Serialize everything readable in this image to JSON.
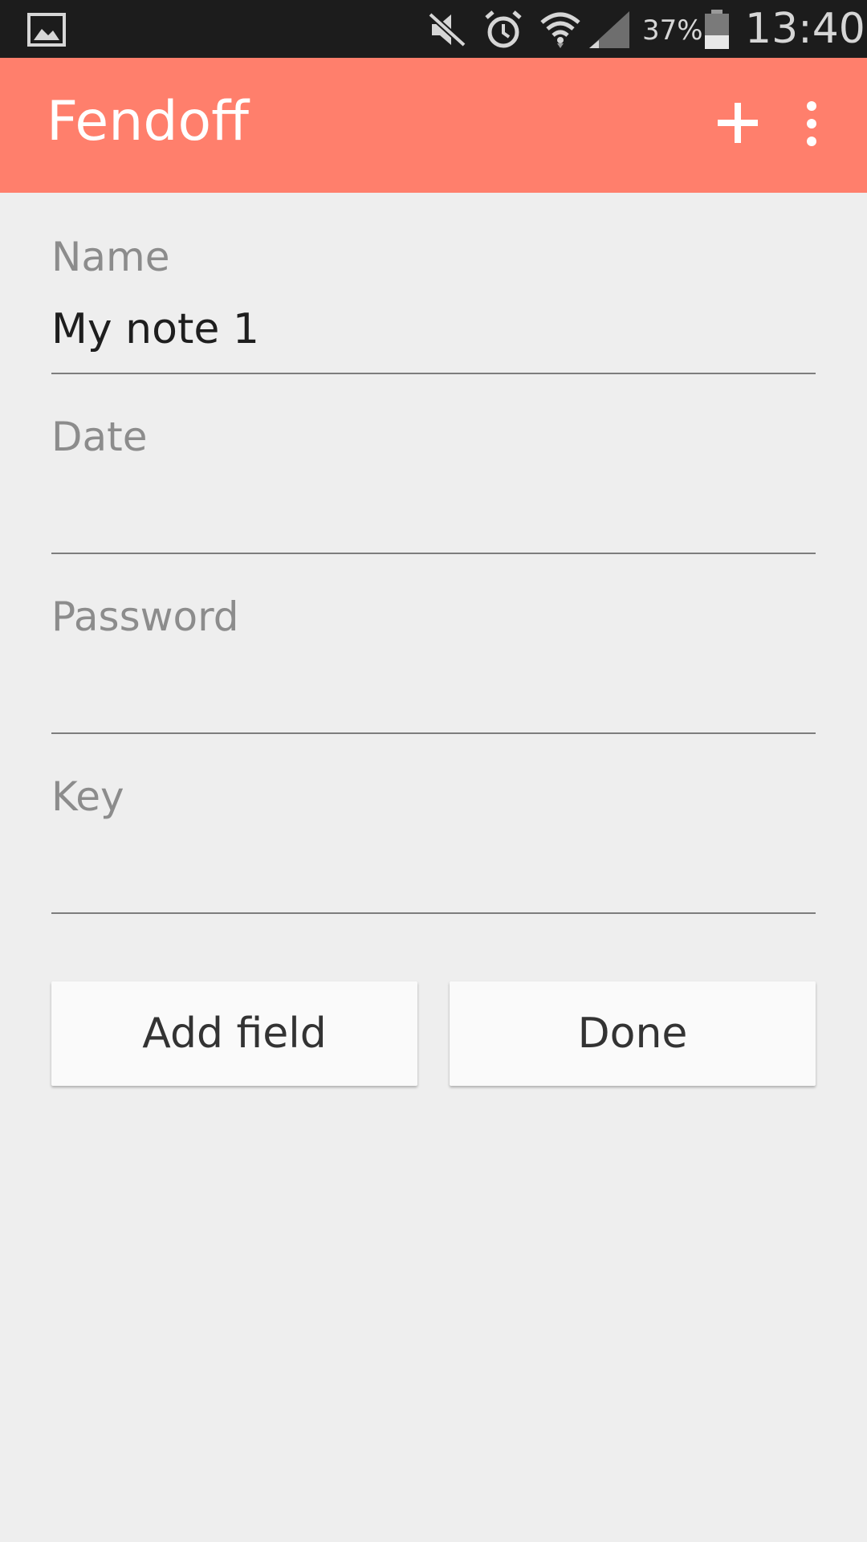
{
  "status_bar": {
    "battery_percent": "37%",
    "time": "13:40",
    "icons": [
      "gallery-notification-icon",
      "mute-icon",
      "alarm-icon",
      "wifi-icon",
      "signal-icon",
      "battery-icon"
    ]
  },
  "app_bar": {
    "title": "Fendoff",
    "actions": [
      "add-icon",
      "overflow-menu-icon"
    ]
  },
  "form": {
    "fields": [
      {
        "label": "Name",
        "value": "My note 1"
      },
      {
        "label": "Date",
        "value": ""
      },
      {
        "label": "Password",
        "value": ""
      },
      {
        "label": "Key",
        "value": ""
      }
    ]
  },
  "buttons": {
    "add_field": "Add field",
    "done": "Done"
  },
  "colors": {
    "app_bar": "#ff7f6c",
    "status_bar": "#1c1c1c",
    "background": "#eeeeee"
  }
}
